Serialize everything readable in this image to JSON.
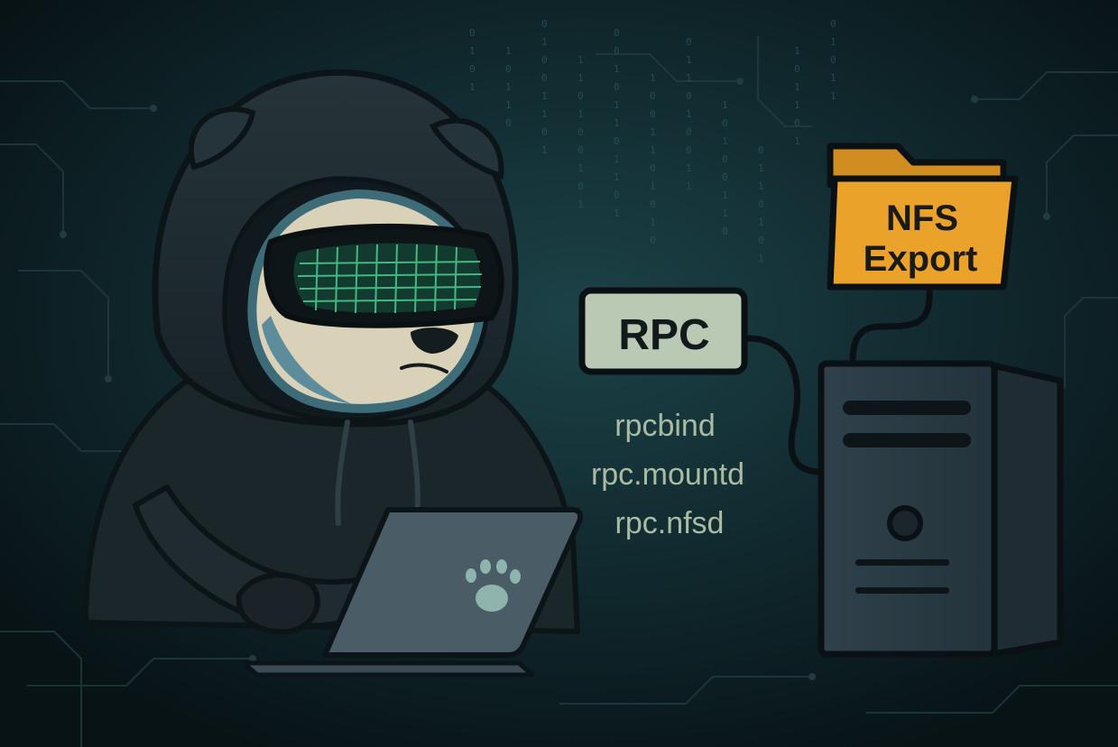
{
  "rpc_label": "RPC",
  "services": [
    "rpcbind",
    "rpc.mountd",
    "rpc.nfsd"
  ],
  "folder_label": {
    "line1": "NFS",
    "line2": "Export"
  },
  "colors": {
    "background": "#0d2126",
    "hoodie": "#1f2b30",
    "fur": "#d9d2b8",
    "goggle_grid": "#49c58f",
    "rpc_box": "#b9c9b3",
    "service_text": "#a9bba2",
    "folder": "#eaa22a",
    "server": "#2a3a43"
  },
  "icons": [
    "paw-icon",
    "folder-icon",
    "server-icon",
    "goggles-icon"
  ]
}
